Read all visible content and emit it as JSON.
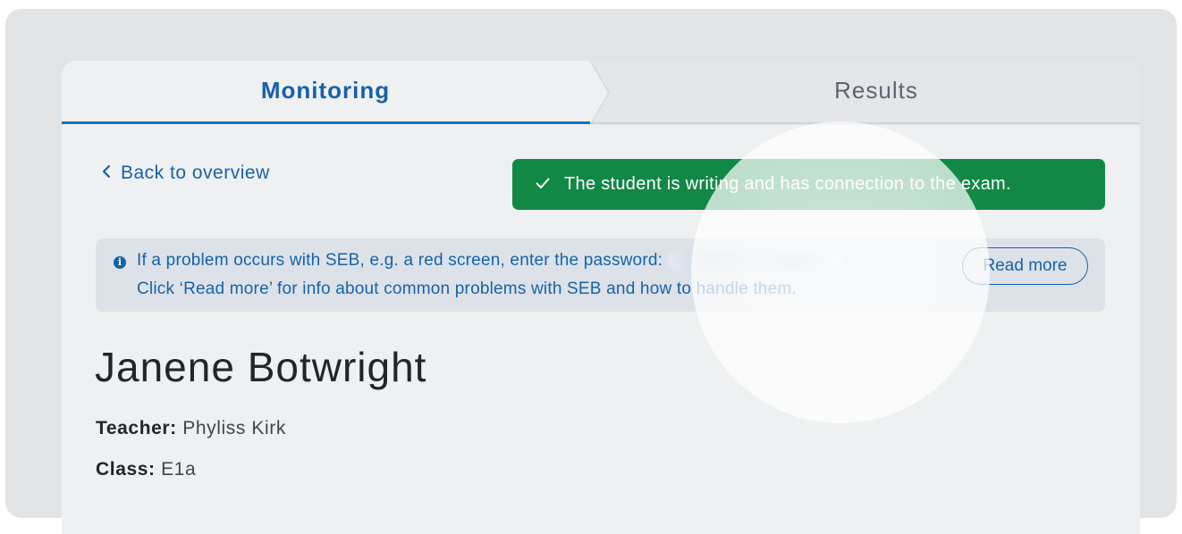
{
  "tabs": {
    "monitoring": "Monitoring",
    "results": "Results"
  },
  "back": {
    "label": "Back to overview"
  },
  "status": {
    "message": "The student is writing and has connection to the exam.",
    "color": "#128845"
  },
  "info": {
    "line1": "If a problem occurs with SEB, e.g. a red screen, enter the password:",
    "line2": "Click ‘Read more’ for info about common problems with SEB and how to handle them.",
    "read_more_label": "Read more"
  },
  "student": {
    "name": "Janene Botwright",
    "teacher_label": "Teacher:",
    "teacher": "Phyliss Kirk",
    "class_label": "Class:",
    "class": "E1a"
  },
  "colors": {
    "accent": "#1462a8",
    "success": "#128845"
  }
}
